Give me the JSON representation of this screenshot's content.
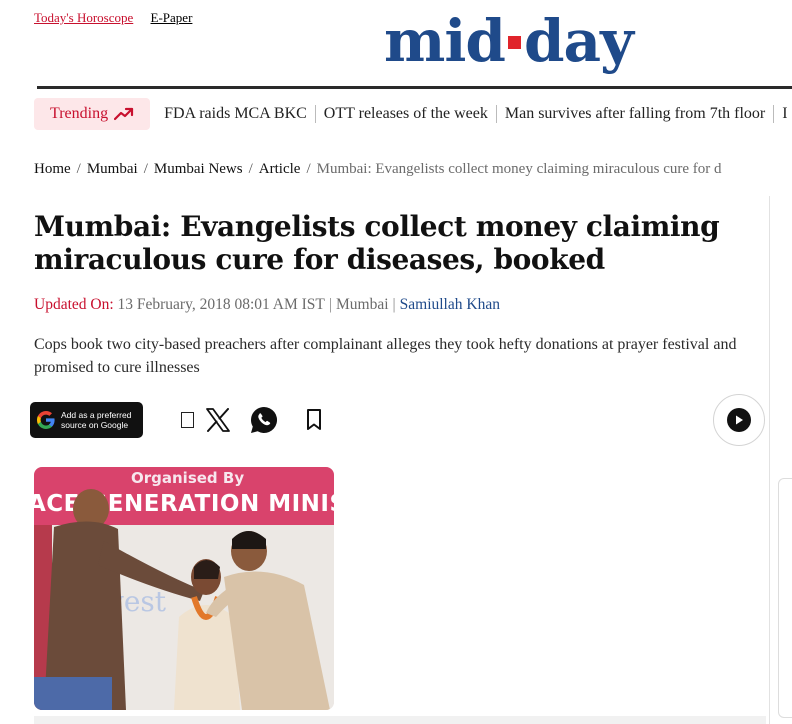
{
  "top_links": {
    "horoscope": "Today's Horoscope",
    "epaper": "E-Paper"
  },
  "logo": {
    "left": "mid",
    "right": "day"
  },
  "trending": {
    "label": "Trending",
    "items": [
      "FDA raids MCA BKC",
      "OTT releases of the week",
      "Man survives after falling from 7th floor",
      "I"
    ]
  },
  "breadcrumb": {
    "home": "Home",
    "mumbai": "Mumbai",
    "mumbai_news": "Mumbai News",
    "article": "Article",
    "current": "Mumbai: Evangelists collect money claiming miraculous cure for d"
  },
  "article": {
    "headline": "Mumbai: Evangelists collect money claiming miraculous cure for diseases, booked",
    "updated_label": "Updated On:",
    "date": "13 February, 2018 08:01 AM IST",
    "location": "Mumbai",
    "author": "Samiullah Khan",
    "summary": "Cops book two city-based preachers after complainant alleges they took hefty donations at prayer festival and promised to cure illnesses"
  },
  "google_button": {
    "line1": "Add as a preferred",
    "line2": "source on Google"
  },
  "photo": {
    "banner_top": "Organised By",
    "banner_main": "ACE GENERATION MINISTRI",
    "wall_text": "yest"
  },
  "colors": {
    "brand_blue": "#1f4a8a",
    "brand_red": "#e0242b",
    "accent_red": "#c8102e",
    "trending_bg": "#fde7e9"
  }
}
